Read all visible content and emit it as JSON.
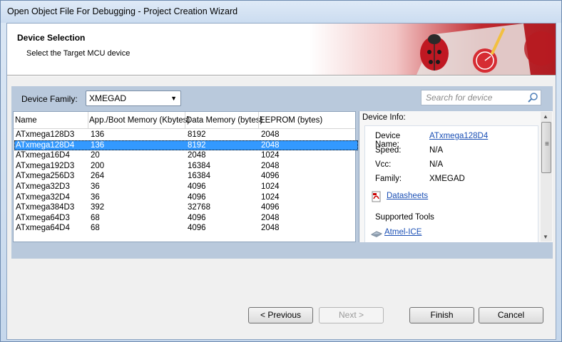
{
  "window": {
    "title": "Open Object File For Debugging  -  Project Creation Wizard"
  },
  "header": {
    "title": "Device Selection",
    "subtitle": "Select the Target MCU device"
  },
  "toolbar": {
    "family_label": "Device Family:",
    "family_value": "XMEGAD",
    "search_placeholder": "Search for device"
  },
  "table": {
    "columns": [
      "Name",
      "App./Boot Memory (Kbytes)",
      "Data Memory (bytes)",
      "EEPROM (bytes)"
    ],
    "rows": [
      [
        "ATxmega128D3",
        "136",
        "8192",
        "2048"
      ],
      [
        "ATxmega128D4",
        "136",
        "8192",
        "2048"
      ],
      [
        "ATxmega16D4",
        "20",
        "2048",
        "1024"
      ],
      [
        "ATxmega192D3",
        "200",
        "16384",
        "2048"
      ],
      [
        "ATxmega256D3",
        "264",
        "16384",
        "4096"
      ],
      [
        "ATxmega32D3",
        "36",
        "4096",
        "1024"
      ],
      [
        "ATxmega32D4",
        "36",
        "4096",
        "1024"
      ],
      [
        "ATxmega384D3",
        "392",
        "32768",
        "4096"
      ],
      [
        "ATxmega64D3",
        "68",
        "4096",
        "2048"
      ],
      [
        "ATxmega64D4",
        "68",
        "4096",
        "2048"
      ]
    ],
    "selected_index": 1
  },
  "device_info": {
    "title": "Device Info:",
    "device_name_label": "Device Name:",
    "device_name_value": "ATxmega128D4",
    "speed_label": "Speed:",
    "speed_value": "N/A",
    "vcc_label": "Vcc:",
    "vcc_value": "N/A",
    "family_label": "Family:",
    "family_value": "XMEGAD",
    "datasheets_link": "Datasheets",
    "supported_tools_label": "Supported Tools",
    "tool_link": "Atmel-ICE"
  },
  "buttons": {
    "previous": "< Previous",
    "next": "Next >",
    "finish": "Finish",
    "cancel": "Cancel"
  },
  "colors": {
    "selection": "#3399ff",
    "link": "#1a4fb5",
    "panel": "#b9c9dc"
  }
}
